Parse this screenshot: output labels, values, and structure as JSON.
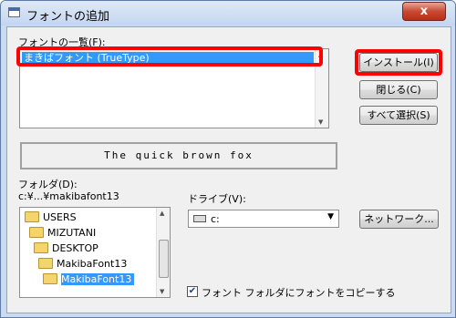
{
  "window": {
    "title": "フォントの追加",
    "close_glyph": "x"
  },
  "fonts": {
    "label": "フォントの一覧(F):",
    "selected_item": "まきばフォント (TrueType)",
    "preview_text": "The quick brown fox"
  },
  "buttons": {
    "install": "インストール(I)",
    "close": "閉じる(C)",
    "select_all": "すべて選択(S)",
    "network": "ネットワーク..."
  },
  "folder": {
    "label": "フォルダ(D):",
    "path": "c:¥...¥makibafont13",
    "tree": [
      "USERS",
      "MIZUTANI",
      "DESKTOP",
      "MakibaFont13",
      "MakibaFont13"
    ],
    "selected_index": 4
  },
  "drive": {
    "label": "ドライブ(V):",
    "value": "c:"
  },
  "copy_option": {
    "label": "フォント フォルダにフォントをコピーする",
    "checked": true
  },
  "colors": {
    "highlight": "#ff0000",
    "selection": "#3399ff"
  }
}
